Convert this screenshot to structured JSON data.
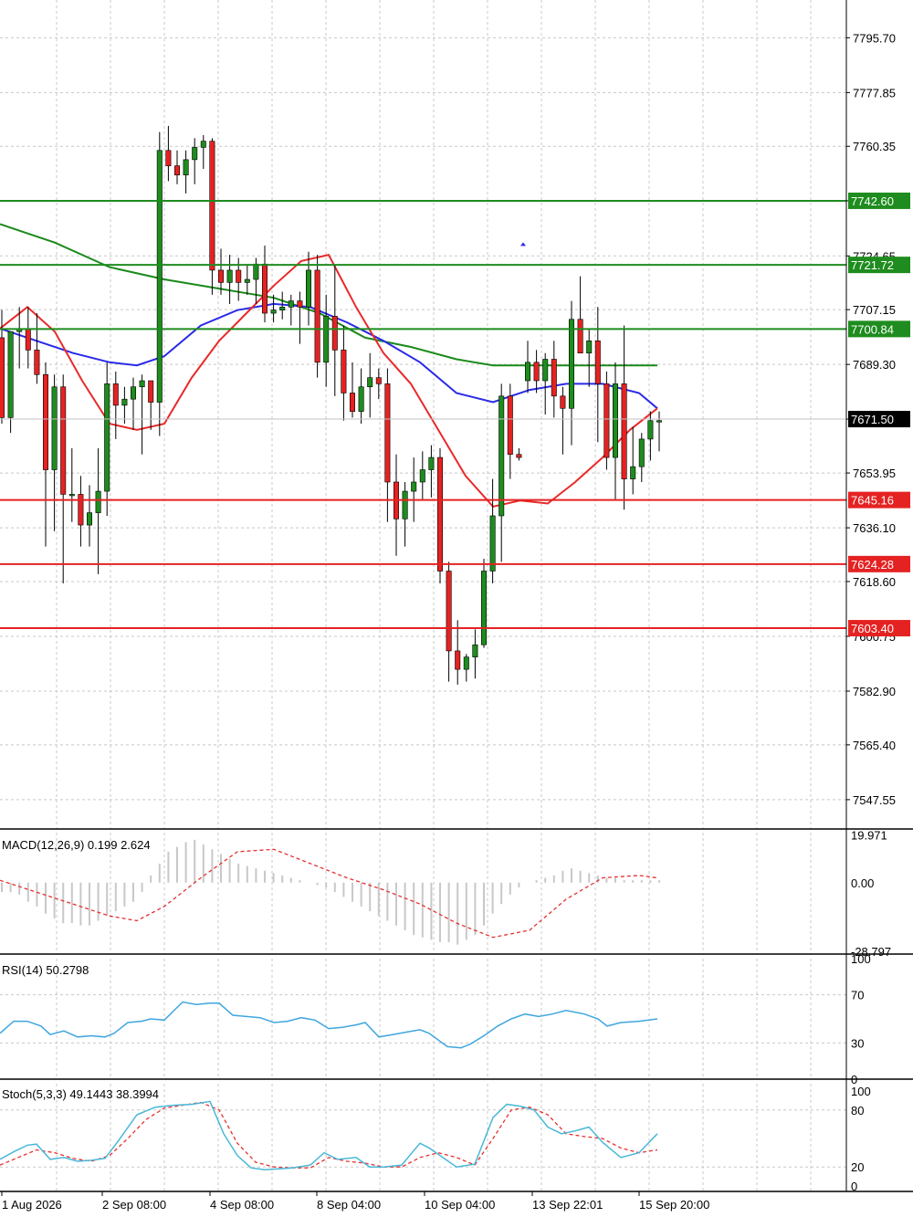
{
  "chart_data": [
    {
      "type": "candlestick",
      "panel": "price",
      "y_ticks": [
        "7795.70",
        "7777.85",
        "7760.35",
        "7742.60",
        "7724.65",
        "7707.15",
        "7689.30",
        "7671.50",
        "7653.95",
        "7636.10",
        "7618.60",
        "7600.75",
        "7582.90",
        "7565.40",
        "7547.55"
      ],
      "ylim": [
        7538,
        7808
      ],
      "current_price": "7671.50",
      "levels": [
        {
          "value": 7742.6,
          "label": "7742.60",
          "color": "#1e8c1e",
          "role": "resistance"
        },
        {
          "value": 7721.72,
          "label": "7721.72",
          "color": "#1e8c1e",
          "role": "resistance"
        },
        {
          "value": 7700.84,
          "label": "7700.84",
          "color": "#1e8c1e",
          "role": "resistance"
        },
        {
          "value": 7645.16,
          "label": "7645.16",
          "color": "#e52222",
          "role": "support"
        },
        {
          "value": 7624.28,
          "label": "7624.28",
          "color": "#e52222",
          "role": "support"
        },
        {
          "value": 7603.4,
          "label": "7603.40",
          "color": "#e52222",
          "role": "support"
        }
      ],
      "candles": [
        [
          7698,
          7707,
          7670,
          7672
        ],
        [
          7672,
          7698,
          7667,
          7700
        ],
        [
          7700,
          7708,
          7688,
          7701
        ],
        [
          7701,
          7708,
          7688,
          7694
        ],
        [
          7694,
          7706,
          7683,
          7686
        ],
        [
          7686,
          7690,
          7630,
          7655
        ],
        [
          7655,
          7686,
          7635,
          7682
        ],
        [
          7682,
          7686,
          7618,
          7647
        ],
        [
          7647,
          7662,
          7638,
          7647
        ],
        [
          7647,
          7653,
          7630,
          7637
        ],
        [
          7637,
          7650,
          7630,
          7641
        ],
        [
          7641,
          7662,
          7621,
          7648
        ],
        [
          7648,
          7690,
          7640,
          7683
        ],
        [
          7683,
          7687,
          7665,
          7676
        ],
        [
          7676,
          7682,
          7670,
          7678
        ],
        [
          7678,
          7685,
          7668,
          7682
        ],
        [
          7682,
          7686,
          7660,
          7684
        ],
        [
          7684,
          7683,
          7668,
          7677
        ],
        [
          7677,
          7765,
          7666,
          7759
        ],
        [
          7759,
          7767,
          7749,
          7754
        ],
        [
          7754,
          7759,
          7748,
          7751
        ],
        [
          7751,
          7759,
          7745,
          7756
        ],
        [
          7756,
          7763,
          7748,
          7760
        ],
        [
          7760,
          7764,
          7753,
          7762
        ],
        [
          7762,
          7763,
          7712,
          7720
        ],
        [
          7720,
          7727,
          7712,
          7716
        ],
        [
          7716,
          7725,
          7709,
          7720
        ],
        [
          7720,
          7724,
          7710,
          7716
        ],
        [
          7716,
          7722,
          7712,
          7717
        ],
        [
          7717,
          7724,
          7709,
          7722
        ],
        [
          7722,
          7728,
          7703,
          7706
        ],
        [
          7706,
          7712,
          7703,
          7707
        ],
        [
          7707,
          7713,
          7704,
          7708
        ],
        [
          7708,
          7712,
          7702,
          7710
        ],
        [
          7710,
          7713,
          7696,
          7708
        ],
        [
          7708,
          7726,
          7702,
          7720
        ],
        [
          7720,
          7725,
          7685,
          7690
        ],
        [
          7690,
          7712,
          7682,
          7705
        ],
        [
          7705,
          7722,
          7679,
          7694
        ],
        [
          7694,
          7702,
          7671,
          7680
        ],
        [
          7680,
          7690,
          7672,
          7674
        ],
        [
          7674,
          7688,
          7670,
          7682
        ],
        [
          7682,
          7693,
          7672,
          7685
        ],
        [
          7685,
          7688,
          7678,
          7683
        ],
        [
          7683,
          7688,
          7638,
          7651
        ],
        [
          7651,
          7660,
          7627,
          7639
        ],
        [
          7639,
          7651,
          7630,
          7648
        ],
        [
          7648,
          7659,
          7638,
          7651
        ],
        [
          7651,
          7661,
          7645,
          7655
        ],
        [
          7655,
          7663,
          7646,
          7659
        ],
        [
          7659,
          7662,
          7618,
          7622
        ],
        [
          7622,
          7625,
          7586,
          7596
        ],
        [
          7596,
          7606,
          7585,
          7590
        ],
        [
          7590,
          7595,
          7586,
          7594
        ],
        [
          7594,
          7603,
          7587,
          7598
        ],
        [
          7598,
          7626,
          7597,
          7622
        ],
        [
          7622,
          7652,
          7618,
          7640
        ],
        [
          7640,
          7683,
          7625,
          7679
        ],
        [
          7679,
          7683,
          7652,
          7660
        ],
        [
          7660,
          7662,
          7658,
          7659
        ],
        [
          7684,
          7697,
          7680,
          7690
        ],
        [
          7690,
          7694,
          7680,
          7684
        ],
        [
          7684,
          7693,
          7673,
          7691
        ],
        [
          7691,
          7697,
          7672,
          7679
        ],
        [
          7679,
          7682,
          7660,
          7675
        ],
        [
          7675,
          7710,
          7663,
          7704
        ],
        [
          7704,
          7718,
          7694,
          7693
        ],
        [
          7693,
          7701,
          7682,
          7697
        ],
        [
          7697,
          7708,
          7664,
          7683
        ],
        [
          7683,
          7687,
          7655,
          7659
        ],
        [
          7659,
          7690,
          7645,
          7683
        ],
        [
          7683,
          7702,
          7642,
          7652
        ],
        [
          7652,
          7669,
          7647,
          7656
        ],
        [
          7656,
          7667,
          7651,
          7665
        ],
        [
          7665,
          7674,
          7658,
          7671
        ],
        [
          7671,
          7674,
          7661,
          7671
        ]
      ],
      "moving_averages": [
        {
          "color": "#1a8a1a",
          "x": [
            0,
            60,
            120,
            180,
            240,
            300,
            350,
            400,
            450,
            500,
            540,
            580,
            620,
            680,
            720
          ],
          "y": [
            7735,
            7729,
            7721,
            7717,
            7714,
            7711,
            7706,
            7698,
            7695,
            7691,
            7689,
            7689,
            7689,
            7689,
            7689
          ]
        },
        {
          "color": "#2a2ae8",
          "x": [
            0,
            40,
            80,
            120,
            150,
            180,
            220,
            260,
            300,
            340,
            380,
            420,
            460,
            500,
            540,
            580,
            620,
            660,
            700,
            720
          ],
          "y": [
            7701,
            7697,
            7693,
            7690,
            7689,
            7692,
            7702,
            7707,
            7709,
            7708,
            7703,
            7697,
            7690,
            7680,
            7677,
            7681,
            7683,
            7683,
            7680,
            7675
          ]
        },
        {
          "color": "#e82a2a",
          "x": [
            0,
            30,
            60,
            90,
            120,
            150,
            180,
            210,
            240,
            270,
            300,
            330,
            360,
            390,
            420,
            450,
            480,
            510,
            540,
            570,
            600,
            630,
            660,
            690,
            720
          ],
          "y": [
            7701,
            7708,
            7700,
            7684,
            7670,
            7668,
            7670,
            7685,
            7697,
            7706,
            7715,
            7723,
            7725,
            7708,
            7693,
            7683,
            7668,
            7653,
            7643,
            7645,
            7644,
            7651,
            7659,
            7668,
            7675
          ]
        }
      ],
      "marker": {
        "value": 7728.5
      }
    },
    {
      "type": "bar+line",
      "panel": "macd",
      "title": "MACD(12,26,9) 0.199 2.624",
      "y_ticks": [
        "19.971",
        "0.00",
        "-28.797"
      ],
      "ylim": [
        -30,
        21
      ],
      "histogram": [
        -4,
        -4,
        -5,
        -8,
        -10,
        -13,
        -15,
        -17,
        -17,
        -18,
        -18,
        -16,
        -14,
        -12,
        -10,
        -8,
        -4,
        3,
        8,
        13,
        15,
        17,
        18,
        16,
        14,
        12,
        10,
        8,
        7,
        6,
        5,
        4,
        3,
        2,
        1,
        0,
        -1,
        -2,
        -4,
        -6,
        -8,
        -10,
        -12,
        -14,
        -16,
        -18,
        -20,
        -22,
        -23,
        -24,
        -25,
        -25,
        -26,
        -24,
        -22,
        -18,
        -13,
        -9,
        -5,
        -2,
        0,
        1,
        2,
        3,
        5,
        6,
        5,
        4,
        3,
        2,
        2,
        1,
        1,
        1,
        1,
        1
      ],
      "signal": {
        "x": [
          0,
          40,
          80,
          120,
          150,
          180,
          220,
          260,
          300,
          340,
          380,
          420,
          460,
          500,
          540,
          580,
          620,
          660,
          700,
          720
        ],
        "y": [
          1,
          -4,
          -9,
          -14,
          -16,
          -10,
          2,
          13,
          14,
          8,
          2,
          -3,
          -9,
          -17,
          -23,
          -20,
          -7,
          2,
          3,
          2
        ]
      }
    },
    {
      "type": "line",
      "panel": "rsi",
      "title": "RSI(14) 50.2798",
      "y_ticks": [
        "100",
        "70",
        "30",
        "0"
      ],
      "ylim": [
        0,
        100
      ],
      "x": [
        0,
        15,
        30,
        45,
        55,
        70,
        85,
        100,
        115,
        125,
        140,
        155,
        165,
        180,
        200,
        215,
        230,
        240,
        255,
        270,
        285,
        300,
        315,
        330,
        345,
        360,
        375,
        390,
        400,
        415,
        430,
        445,
        460,
        470,
        490,
        505,
        515,
        530,
        545,
        560,
        575,
        590,
        605,
        620,
        640,
        655,
        665,
        680,
        700,
        720
      ],
      "y": [
        38,
        48,
        48,
        44,
        37,
        40,
        35,
        36,
        35,
        38,
        47,
        48,
        50,
        49,
        64,
        62,
        63,
        63,
        53,
        52,
        51,
        47,
        48,
        51,
        49,
        42,
        43,
        45,
        47,
        35,
        37,
        39,
        41,
        38,
        27,
        26,
        29,
        36,
        44,
        50,
        54,
        52,
        54,
        57,
        54,
        50,
        44,
        47,
        48,
        50
      ]
    },
    {
      "type": "line",
      "panel": "stochastic",
      "title": "Stoch(5,3,3) 49.1443 38.3994",
      "y_ticks": [
        "100",
        "80",
        "20",
        "0"
      ],
      "ylim": [
        0,
        100
      ],
      "main": {
        "x": [
          0,
          15,
          30,
          40,
          55,
          70,
          85,
          100,
          115,
          130,
          150,
          170,
          190,
          210,
          230,
          245,
          260,
          275,
          290,
          305,
          320,
          340,
          355,
          370,
          390,
          405,
          420,
          440,
          460,
          470,
          485,
          500,
          520,
          540,
          555,
          570,
          585,
          600,
          615,
          630,
          645,
          660,
          680,
          700,
          720
        ],
        "y": [
          28,
          36,
          43,
          44,
          28,
          30,
          26,
          27,
          29,
          48,
          75,
          83,
          85,
          86,
          89,
          55,
          32,
          19,
          17,
          18,
          19,
          22,
          35,
          28,
          30,
          20,
          20,
          22,
          45,
          40,
          30,
          20,
          23,
          72,
          86,
          84,
          80,
          62,
          55,
          58,
          62,
          46,
          30,
          35,
          55
        ]
      },
      "signal": {
        "x": [
          0,
          20,
          40,
          60,
          80,
          100,
          120,
          140,
          160,
          180,
          200,
          220,
          240,
          260,
          280,
          300,
          320,
          340,
          360,
          380,
          400,
          420,
          440,
          460,
          480,
          500,
          520,
          540,
          560,
          580,
          600,
          620,
          640,
          660,
          680,
          700,
          720
        ],
        "y": [
          22,
          30,
          38,
          35,
          29,
          26,
          32,
          50,
          70,
          82,
          85,
          88,
          80,
          45,
          25,
          20,
          19,
          19,
          30,
          26,
          24,
          20,
          20,
          30,
          35,
          30,
          22,
          50,
          80,
          83,
          75,
          55,
          52,
          50,
          40,
          35,
          38
        ]
      }
    },
    {
      "type": "axis",
      "x_tick_labels": [
        "1 Aug 2026",
        "2 Sep 08:00",
        "4 Sep 08:00",
        "8 Sep 04:00",
        "10 Sep 04:00",
        "13 Sep 22:01",
        "15 Sep 20:00"
      ]
    }
  ],
  "colors": {
    "bull": "#1e8c1e",
    "bear": "#e52222",
    "grid": "#c8c8c8",
    "macd_hist": "#c8c8c8",
    "macd_signal": "#e53030",
    "rsi_line": "#3fa6e0",
    "stoch_main": "#49b8d8",
    "stoch_signal": "#e53030"
  }
}
